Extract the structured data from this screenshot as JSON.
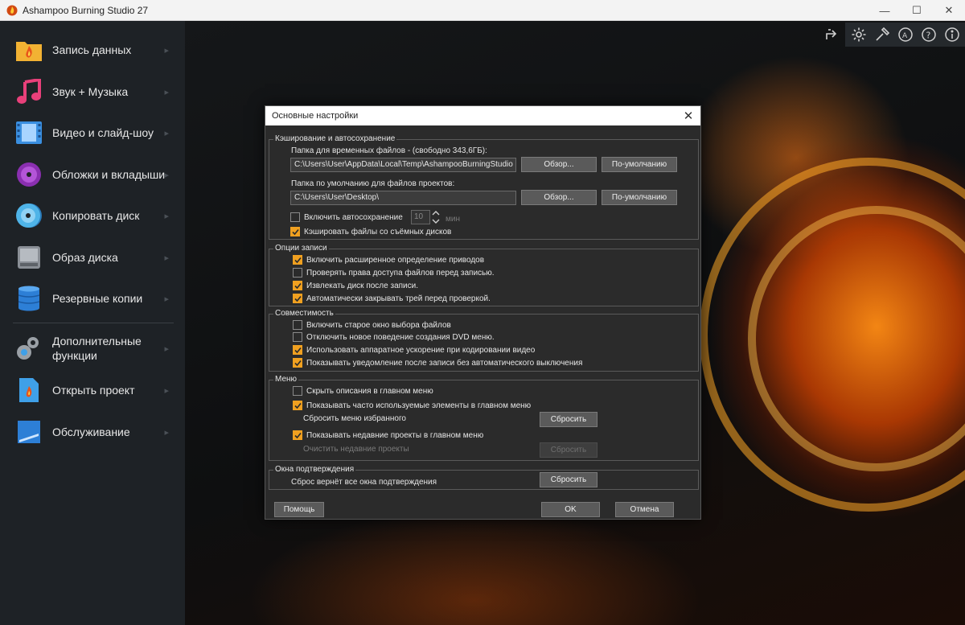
{
  "window": {
    "title": "Ashampoo Burning Studio 27",
    "minimize": "—",
    "maximize": "☐",
    "close": "✕"
  },
  "sidebar": {
    "items": [
      {
        "label": "Запись данных",
        "icon": "folder-flame-icon"
      },
      {
        "label": "Звук + Музыка",
        "icon": "music-note-icon"
      },
      {
        "label": "Видео и слайд-шоу",
        "icon": "film-icon"
      },
      {
        "label": "Обложки и вкладыши",
        "icon": "disc-cover-icon"
      },
      {
        "label": "Копировать диск",
        "icon": "disc-copy-icon"
      },
      {
        "label": "Образ диска",
        "icon": "disc-image-icon"
      },
      {
        "label": "Резервные копии",
        "icon": "database-icon"
      },
      {
        "label": "Дополнительные\nфункции",
        "icon": "gears-icon"
      },
      {
        "label": "Открыть проект",
        "icon": "project-file-icon"
      },
      {
        "label": "Обслуживание",
        "icon": "maintenance-icon"
      }
    ],
    "chevron": "▸"
  },
  "toolbar": {
    "icons": [
      "share-icon",
      "settings-gear-icon",
      "tools-icon",
      "accessibility-icon",
      "help-icon",
      "info-icon"
    ]
  },
  "dialog": {
    "title": "Основные настройки",
    "close": "✕",
    "caching": {
      "label": "Кэширование и автосохранение",
      "temp_folder_label": "Папка для временных файлов - (свободно 343,6ГБ):",
      "temp_folder_value": "C:\\Users\\User\\AppData\\Local\\Temp\\AshampooBurningStudio",
      "browse": "Обзор...",
      "default": "По-умолчанию",
      "project_folder_label": "Папка по умолчанию для файлов проектов:",
      "project_folder_value": "C:\\Users\\User\\Desktop\\",
      "autosave_label": "Включить автосохранение",
      "autosave_checked": false,
      "autosave_minutes": "10",
      "minutes_unit": "мин",
      "cache_removable_label": "Кэшировать файлы со съёмных дисков",
      "cache_removable_checked": true
    },
    "write_options": {
      "label": "Опции записи",
      "items": [
        {
          "label": "Включить расширенное определение приводов",
          "checked": true
        },
        {
          "label": "Проверять права доступа файлов перед записью.",
          "checked": false
        },
        {
          "label": "Извлекать диск после записи.",
          "checked": true
        },
        {
          "label": "Автоматически закрывать трей перед проверкой.",
          "checked": true
        }
      ]
    },
    "compat": {
      "label": "Совместимость",
      "items": [
        {
          "label": "Включить старое окно выбора файлов",
          "checked": false
        },
        {
          "label": "Отключить новое поведение создания DVD меню.",
          "checked": false
        },
        {
          "label": "Использовать аппаратное ускорение при кодировании видео",
          "checked": true
        },
        {
          "label": "Показывать уведомление после записи без автоматического выключения",
          "checked": true
        }
      ]
    },
    "menu": {
      "label": "Меню",
      "hide_desc": {
        "label": "Скрыть описания в главном меню",
        "checked": false
      },
      "show_frequent": {
        "label": "Показывать часто используемые элементы в главном меню",
        "checked": true
      },
      "reset_fav_label": "Сбросить меню избранного",
      "reset": "Сбросить",
      "show_recent": {
        "label": "Показывать недавние проекты в главном меню",
        "checked": true
      },
      "clear_recent_label": "Очистить недавние проекты"
    },
    "confirm": {
      "label": "Окна подтверждения",
      "text": "Сброс вернёт все окна подтверждения",
      "reset": "Сбросить"
    },
    "help": "Помощь",
    "ok": "OK",
    "cancel": "Отмена"
  },
  "colors": {
    "accent": "#f0a020",
    "sidebar_bg": "#1e2226",
    "dialog_bg": "#2b2b2b"
  }
}
